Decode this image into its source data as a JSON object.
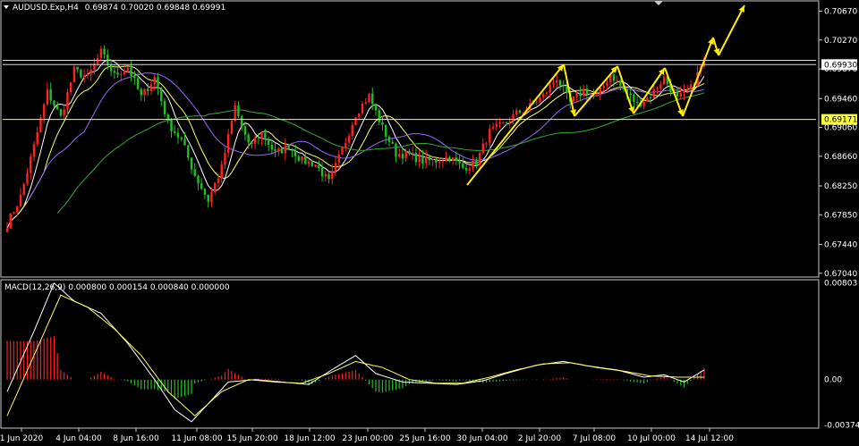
{
  "header": {
    "symbol": "AUDUSD.Exp,H4",
    "ohlc": "0.69874 0.70020 0.69848 0.69991",
    "indicator": "MACD(12,26,9) 0.000800 0.000154 0.000840 0.000000"
  },
  "colors": {
    "background": "#000000",
    "bull": "#ff2020",
    "bear": "#20c020",
    "frame": "#c8c8c8",
    "hline": "#ffff40",
    "arrow": "#ffee00",
    "ma_fast": "#ffffff",
    "ma_mid": "#ffff66",
    "ma_slow": "#9966ff",
    "ma_long": "#33aa33",
    "macd_main": "#ffffff",
    "macd_signal": "#ffff66"
  },
  "chart_data": {
    "type": "candlestick",
    "y_ticks": [
      "0.70670",
      "0.70270",
      "0.69870",
      "0.69460",
      "0.69060",
      "0.68660",
      "0.68250",
      "0.67850",
      "0.67440",
      "0.67040"
    ],
    "y_range": [
      0.67,
      0.708
    ],
    "x_ticks": [
      "1 Jun 2020",
      "4 Jun 04:00",
      "8 Jun 16:00",
      "11 Jun 08:00",
      "15 Jun 20:00",
      "18 Jun 12:00",
      "23 Jun 00:00",
      "25 Jun 16:00",
      "30 Jun 04:00",
      "2 Jul 20:00",
      "7 Jul 08:00",
      "10 Jul 00:00",
      "14 Jul 12:00"
    ],
    "price_tags": [
      {
        "label": "0.69930",
        "value": 0.6993
      },
      {
        "label": "0.69171",
        "value": 0.69171
      }
    ],
    "resistance_lines": [
      0.6993,
      0.6999
    ],
    "macd_ticks": [
      "0.00803",
      "0.00",
      "-0.003749"
    ],
    "macd_range": [
      -0.00395,
      0.0082
    ],
    "trend_arrows_note": "uptrend channel zigzag",
    "close_path": [
      [
        0,
        0.6772
      ],
      [
        4,
        0.681
      ],
      [
        8,
        0.688
      ],
      [
        12,
        0.6955
      ],
      [
        16,
        0.692
      ],
      [
        20,
        0.6985
      ],
      [
        24,
        0.6975
      ],
      [
        28,
        0.701
      ],
      [
        32,
        0.6978
      ],
      [
        36,
        0.699
      ],
      [
        40,
        0.6948
      ],
      [
        44,
        0.6975
      ],
      [
        48,
        0.6912
      ],
      [
        52,
        0.6888
      ],
      [
        56,
        0.684
      ],
      [
        60,
        0.6805
      ],
      [
        64,
        0.685
      ],
      [
        68,
        0.6935
      ],
      [
        72,
        0.688
      ],
      [
        76,
        0.6898
      ],
      [
        80,
        0.687
      ],
      [
        84,
        0.688
      ],
      [
        88,
        0.686
      ],
      [
        92,
        0.6855
      ],
      [
        96,
        0.683
      ],
      [
        100,
        0.6875
      ],
      [
        104,
        0.6925
      ],
      [
        108,
        0.695
      ],
      [
        112,
        0.6905
      ],
      [
        116,
        0.687
      ],
      [
        120,
        0.6868
      ],
      [
        124,
        0.686
      ],
      [
        128,
        0.686
      ],
      [
        132,
        0.6865
      ],
      [
        136,
        0.685
      ],
      [
        140,
        0.6858
      ],
      [
        144,
        0.69
      ],
      [
        148,
        0.691
      ],
      [
        152,
        0.6925
      ],
      [
        156,
        0.6935
      ],
      [
        160,
        0.695
      ],
      [
        164,
        0.6975
      ],
      [
        168,
        0.694
      ],
      [
        172,
        0.6958
      ],
      [
        176,
        0.6948
      ],
      [
        180,
        0.698
      ],
      [
        184,
        0.6958
      ],
      [
        188,
        0.6938
      ],
      [
        192,
        0.695
      ],
      [
        196,
        0.6975
      ],
      [
        200,
        0.6945
      ],
      [
        204,
        0.696
      ],
      [
        208,
        0.6999
      ]
    ],
    "macd_main_path": [
      [
        0,
        -0.001
      ],
      [
        8,
        0.004
      ],
      [
        14,
        0.008
      ],
      [
        20,
        0.0065
      ],
      [
        28,
        0.0055
      ],
      [
        36,
        0.003
      ],
      [
        44,
        0.0
      ],
      [
        50,
        -0.0025
      ],
      [
        55,
        -0.0035
      ],
      [
        60,
        -0.002
      ],
      [
        66,
        -0.0002
      ],
      [
        74,
        0.0
      ],
      [
        82,
        -0.0002
      ],
      [
        90,
        -0.0004
      ],
      [
        98,
        0.001
      ],
      [
        104,
        0.002
      ],
      [
        110,
        0.0005
      ],
      [
        118,
        -0.0002
      ],
      [
        126,
        -0.0003
      ],
      [
        134,
        -0.0004
      ],
      [
        142,
        -0.0001
      ],
      [
        150,
        0.0006
      ],
      [
        158,
        0.0012
      ],
      [
        166,
        0.0015
      ],
      [
        174,
        0.0011
      ],
      [
        182,
        0.0008
      ],
      [
        190,
        0.0002
      ],
      [
        196,
        0.0004
      ],
      [
        202,
        -0.0002
      ],
      [
        208,
        0.0008
      ]
    ],
    "macd_signal_path": [
      [
        0,
        -0.003
      ],
      [
        8,
        0.002
      ],
      [
        16,
        0.007
      ],
      [
        24,
        0.006
      ],
      [
        32,
        0.0042
      ],
      [
        40,
        0.002
      ],
      [
        48,
        -0.001
      ],
      [
        56,
        -0.003
      ],
      [
        64,
        -0.001
      ],
      [
        72,
        0.0
      ],
      [
        80,
        -0.0002
      ],
      [
        88,
        -0.0003
      ],
      [
        96,
        0.0005
      ],
      [
        104,
        0.0015
      ],
      [
        112,
        0.001
      ],
      [
        120,
        0.0
      ],
      [
        128,
        -0.0003
      ],
      [
        136,
        -0.0003
      ],
      [
        144,
        0.0002
      ],
      [
        152,
        0.0008
      ],
      [
        160,
        0.0013
      ],
      [
        168,
        0.0014
      ],
      [
        176,
        0.001
      ],
      [
        184,
        0.0007
      ],
      [
        192,
        0.0003
      ],
      [
        200,
        0.0002
      ],
      [
        208,
        0.0002
      ]
    ]
  }
}
